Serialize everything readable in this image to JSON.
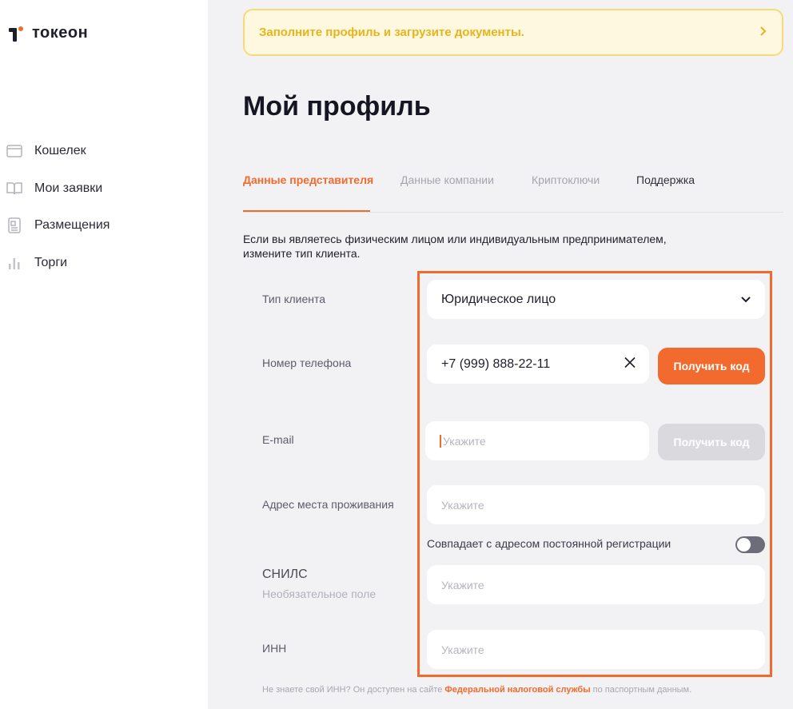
{
  "brand": {
    "name": "токеон",
    "accent_color": "#f26a2e"
  },
  "sidebar": {
    "items": [
      {
        "label": "Кошелек",
        "icon": "wallet-icon"
      },
      {
        "label": "Мои заявки",
        "icon": "book-icon"
      },
      {
        "label": "Размещения",
        "icon": "document-icon"
      },
      {
        "label": "Торги",
        "icon": "bar-chart-icon"
      }
    ]
  },
  "banner": {
    "text": "Заполните профиль и загрузите документы.",
    "icon": "chevron-right-icon"
  },
  "page": {
    "title": "Мой профиль"
  },
  "tabs": [
    {
      "label": "Данные представителя",
      "active": true
    },
    {
      "label": "Данные компании",
      "active": false
    },
    {
      "label": "Криптоключи",
      "active": false
    },
    {
      "label": "Поддержка",
      "active": false
    }
  ],
  "intro": {
    "line1": "Если вы являетесь физическим лицом или индивидуальным предпринимателем,",
    "line2": "измените тип клиента."
  },
  "form": {
    "client_type": {
      "label": "Тип клиента",
      "value": "Юридическое лицо"
    },
    "phone": {
      "label": "Номер телефона",
      "value": "+7 (999) 888-22-11",
      "button": "Получить код"
    },
    "email": {
      "label": "E-mail",
      "placeholder": "Укажите",
      "button": "Получить код"
    },
    "address": {
      "label": "Адрес места проживания",
      "placeholder": "Укажите",
      "toggle_label": "Совпадает с адресом постоянной регистрации",
      "toggle_on": false
    },
    "snils": {
      "label": "СНИЛС",
      "sublabel": "Необязательное поле",
      "placeholder": "Укажите"
    },
    "inn": {
      "label": "ИНН",
      "placeholder": "Укажите"
    }
  },
  "footnote": {
    "before": "Не знаете свой ИНН? Он доступен на сайте ",
    "link": "Федеральной налоговой службы",
    "after": " по паспортным данным."
  },
  "colors": {
    "accent": "#f26a2e",
    "banner_bg": "#fef8e1",
    "banner_text": "#e9b419",
    "highlight_border": "#ee6b2b"
  }
}
